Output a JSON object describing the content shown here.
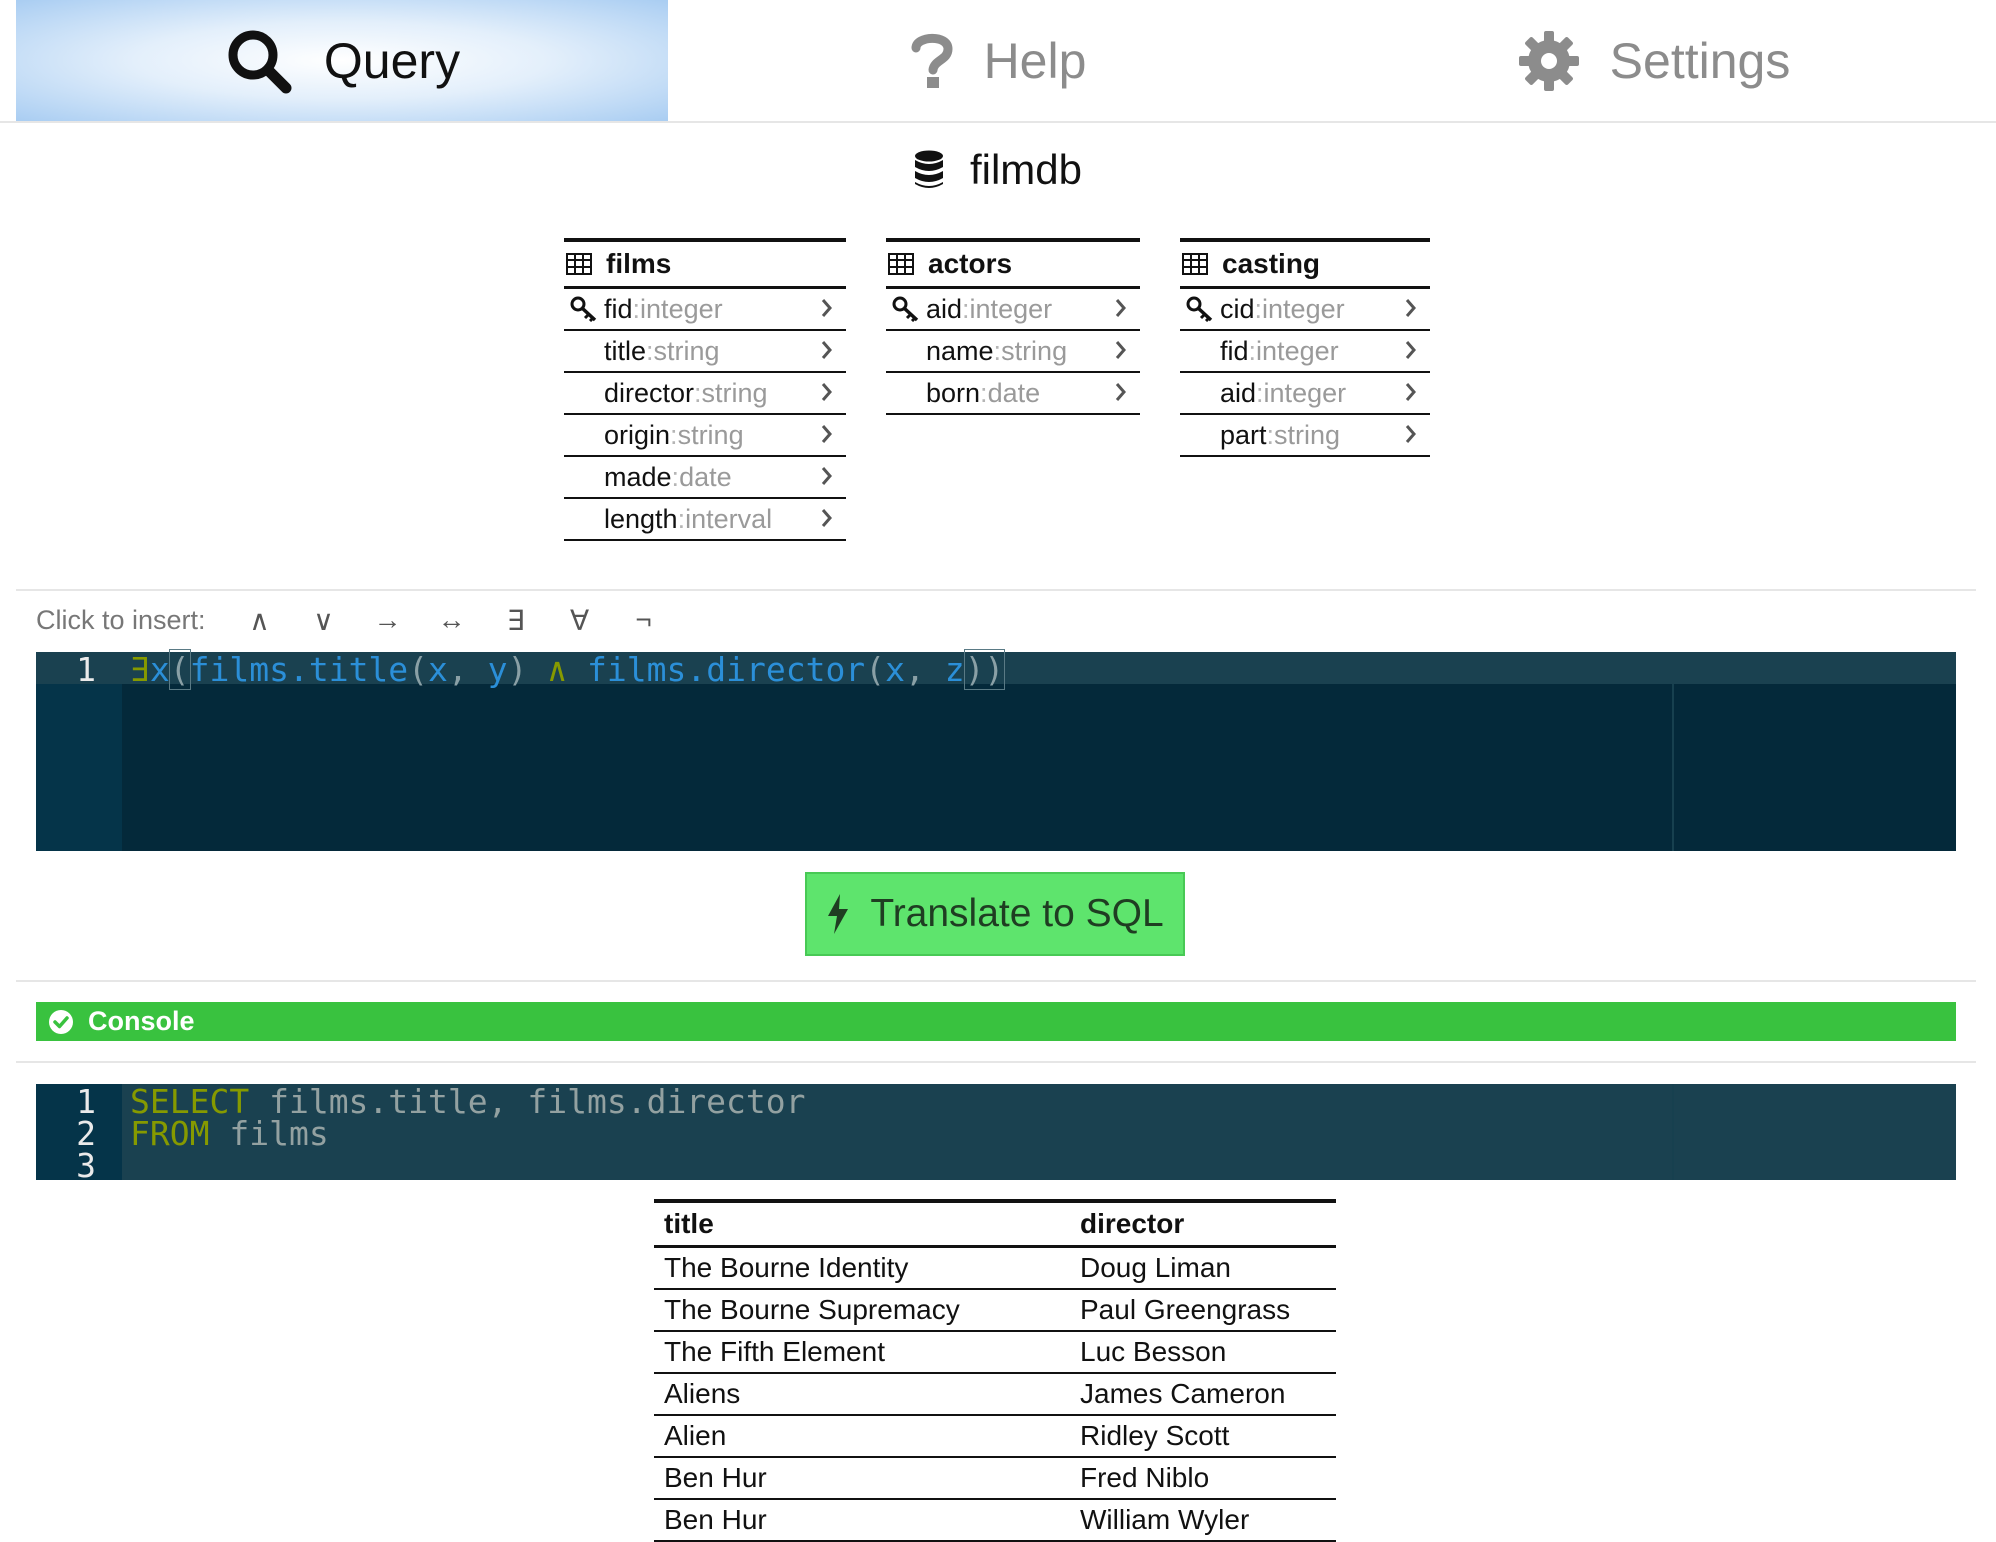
{
  "tabs": [
    {
      "label": "Query",
      "icon": "search-icon",
      "active": true
    },
    {
      "label": "Help",
      "icon": "question-icon",
      "active": false
    },
    {
      "label": "Settings",
      "icon": "gear-icon",
      "active": false
    }
  ],
  "database": {
    "name": "filmdb",
    "icon": "database-icon"
  },
  "schema": {
    "films": {
      "name": "films",
      "fields": [
        {
          "name": "fid",
          "type": "integer",
          "key": true
        },
        {
          "name": "title",
          "type": "string",
          "key": false
        },
        {
          "name": "director",
          "type": "string",
          "key": false
        },
        {
          "name": "origin",
          "type": "string",
          "key": false
        },
        {
          "name": "made",
          "type": "date",
          "key": false
        },
        {
          "name": "length",
          "type": "interval",
          "key": false
        }
      ]
    },
    "actors": {
      "name": "actors",
      "fields": [
        {
          "name": "aid",
          "type": "integer",
          "key": true
        },
        {
          "name": "name",
          "type": "string",
          "key": false
        },
        {
          "name": "born",
          "type": "date",
          "key": false
        }
      ]
    },
    "casting": {
      "name": "casting",
      "fields": [
        {
          "name": "cid",
          "type": "integer",
          "key": true
        },
        {
          "name": "fid",
          "type": "integer",
          "key": false
        },
        {
          "name": "aid",
          "type": "integer",
          "key": false
        },
        {
          "name": "part",
          "type": "string",
          "key": false
        }
      ]
    },
    "type_separator": " : "
  },
  "insert_bar": {
    "label": "Click to insert:",
    "symbols": [
      "∧",
      "∨",
      "→",
      "↔",
      "∃",
      "∀",
      "¬"
    ]
  },
  "query_editor": {
    "line_numbers": [
      "1"
    ],
    "tokens": {
      "exists": "∃",
      "var_x": "x",
      "open": "(",
      "fn1": "films.title",
      "args1_open": "(",
      "a1": "x",
      "comma1": ", ",
      "a2": "y",
      "args1_close": ")",
      "and": " ∧ ",
      "fn2": "films.director",
      "args2_open": "(",
      "b1": "x",
      "comma2": ", ",
      "b2": "z",
      "close": "))"
    }
  },
  "translate_button": {
    "label": "Translate to SQL",
    "icon": "bolt-icon"
  },
  "console": {
    "label": "Console",
    "icon": "check-circle-icon"
  },
  "sql_editor": {
    "line_numbers": [
      "1",
      "2",
      "3"
    ],
    "line1": {
      "keyword": "SELECT",
      "rest": " films.title, films.director"
    },
    "line2": {
      "keyword": "FROM",
      "rest": " films"
    }
  },
  "results": {
    "columns": [
      "title",
      "director"
    ],
    "rows": [
      [
        "The Bourne Identity",
        "Doug Liman"
      ],
      [
        "The Bourne Supremacy",
        "Paul Greengrass"
      ],
      [
        "The Fifth Element",
        "Luc Besson"
      ],
      [
        "Aliens",
        "James Cameron"
      ],
      [
        "Alien",
        "Ridley Scott"
      ],
      [
        "Ben Hur",
        "Fred Niblo"
      ],
      [
        "Ben Hur",
        "William Wyler"
      ]
    ]
  },
  "colors": {
    "active_tab": "#a9cdf2",
    "editor_bg": "#04293a",
    "button_green": "#5ee46d",
    "console_green": "#39c23f",
    "keyword": "#869a00",
    "identifier": "#2b8fd8"
  }
}
